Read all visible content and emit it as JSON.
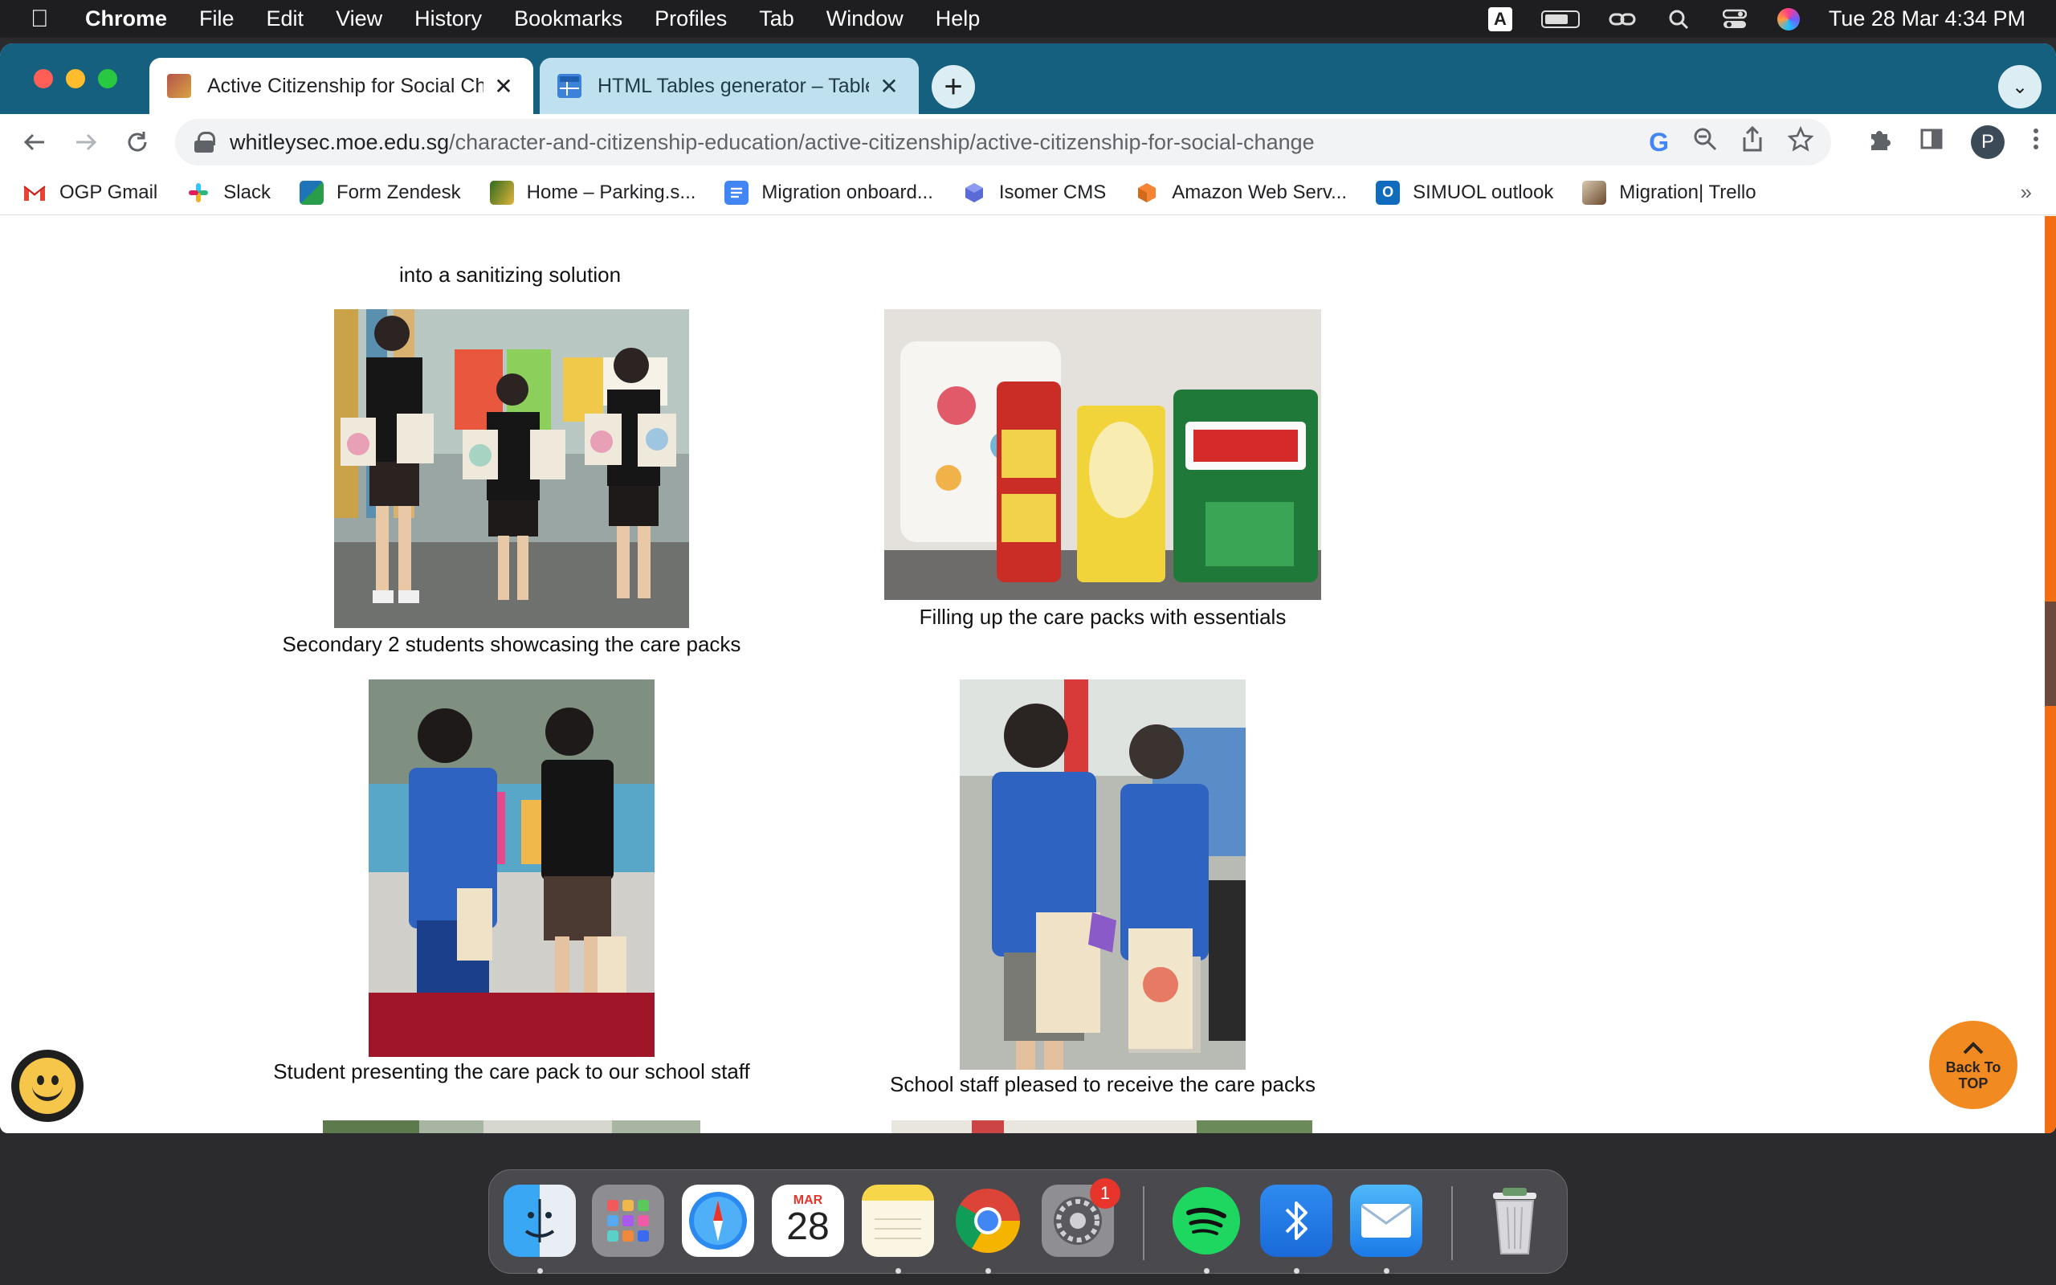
{
  "menubar": {
    "app_name": "Chrome",
    "items": [
      "File",
      "Edit",
      "View",
      "History",
      "Bookmarks",
      "Profiles",
      "Tab",
      "Window",
      "Help"
    ],
    "input_source": "A",
    "clock": "Tue 28 Mar  4:34 PM"
  },
  "browser": {
    "tabs": [
      {
        "title": "Active Citizenship for Social Change",
        "active": true
      },
      {
        "title": "HTML Tables generator – TablesGenerator.com",
        "active": false
      }
    ],
    "new_tab_glyph": "+",
    "tab_search_glyph": "⌄",
    "url_domain": "whitleysec.moe.edu.sg",
    "url_path": "/character-and-citizenship-education/active-citizenship/active-citizenship-for-social-change",
    "profile_initial": "P",
    "bookmarks": [
      {
        "label": "OGP Gmail",
        "icon": "gmail-icon",
        "color": "#ea4335"
      },
      {
        "label": "Slack",
        "icon": "slack-icon",
        "color": "#4a154b"
      },
      {
        "label": "Form Zendesk",
        "icon": "zendesk-icon",
        "color": "#1f73b7"
      },
      {
        "label": "Home – Parking.s...",
        "icon": "parking-icon",
        "color": "#3a7d2a"
      },
      {
        "label": "Migration onboard...",
        "icon": "docs-icon",
        "color": "#4285f4"
      },
      {
        "label": "Isomer CMS",
        "icon": "isomer-icon",
        "color": "#5a6bd8"
      },
      {
        "label": "Amazon Web Serv...",
        "icon": "aws-icon",
        "color": "#f58534"
      },
      {
        "label": "SIMUOL outlook",
        "icon": "outlook-icon",
        "color": "#0f6cbd"
      },
      {
        "label": "Migration| Trello",
        "icon": "trello-icon",
        "color": "#7a5a3a"
      }
    ],
    "bookmarks_overflow": "»"
  },
  "page": {
    "top_caption": "into a sanitizing solution",
    "captions": [
      "Secondary 2 students showcasing the care packs",
      "Filling up the care packs with essentials",
      "Student presenting the care pack to our school staff",
      "School staff pleased to receive the care packs"
    ],
    "back_to_top_line1": "Back To",
    "back_to_top_line2": "TOP"
  },
  "dock": {
    "calendar_month": "MAR",
    "calendar_day": "28",
    "settings_badge": "1",
    "apps": [
      "finder-icon",
      "launchpad-icon",
      "safari-icon",
      "calendar-icon",
      "notes-icon",
      "chrome-icon",
      "system-settings-icon",
      "spotify-icon",
      "bluetooth-icon",
      "mail-icon",
      "trash-icon"
    ]
  }
}
